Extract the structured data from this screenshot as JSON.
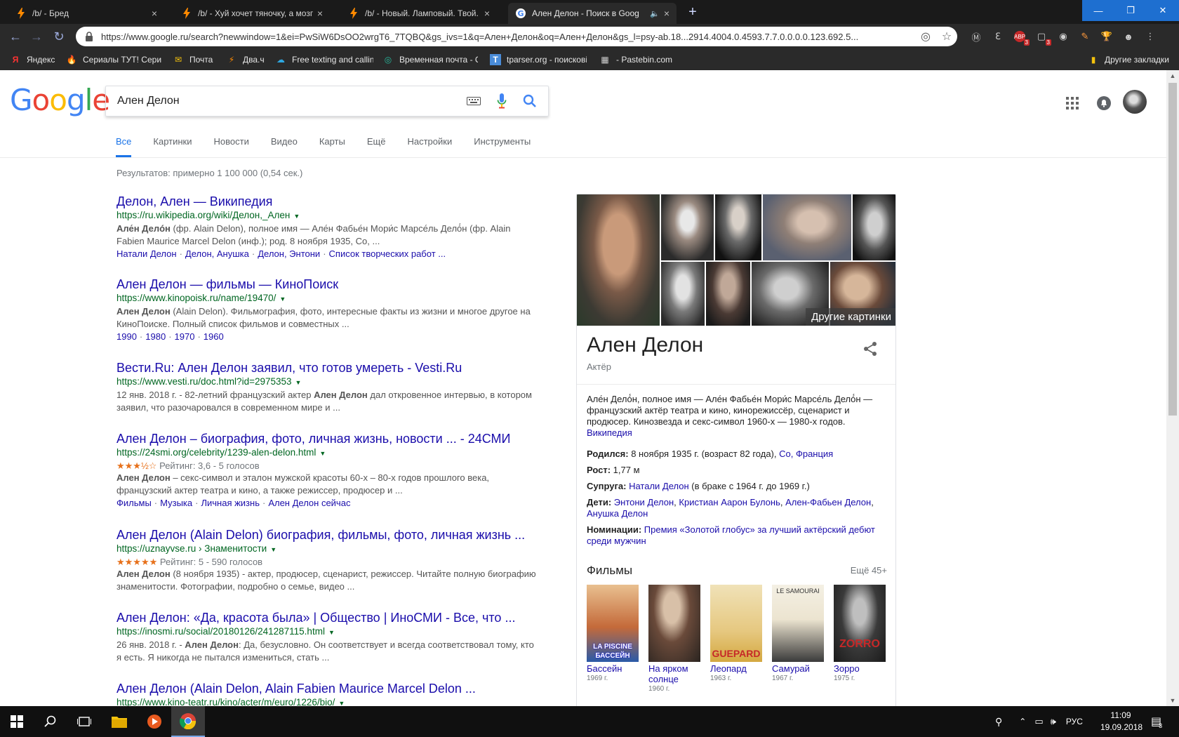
{
  "browser": {
    "tabs": [
      {
        "title": "/b/ - Бред",
        "close": "×",
        "active": false
      },
      {
        "title": "/b/ - Хуй хочет тяночку, а мозг ",
        "close": "×",
        "active": false
      },
      {
        "title": "/b/ - Новый. Ламповый. Твой. Б",
        "close": "×",
        "active": false
      },
      {
        "title": "Ален Делон - Поиск в Goog",
        "close": "×",
        "active": true
      }
    ],
    "new_tab": "+",
    "window_controls": {
      "minimize": "—",
      "maximize": "❐",
      "close": "✕"
    },
    "url": "https://www.google.ru/search?newwindow=1&ei=PwSiW6DsOO2wrgT6_7TQBQ&gs_ivs=1&q=Ален+Делон&oq=Ален+Делон&gs_l=psy-ab.18...2914.4004.0.4593.7.7.0.0.0.0.123.692.5...",
    "extension_badges": [
      "3",
      "3"
    ],
    "bookmarks": [
      {
        "label": "Яндекс",
        "icon": "Я",
        "color": "#ff3333"
      },
      {
        "label": "Сериалы ТУТ! Сериа",
        "icon": "🔥",
        "color": "#ff8a00"
      },
      {
        "label": "Почта",
        "icon": "✉",
        "color": "#f4c20d"
      },
      {
        "label": "Два.ч",
        "icon": "⚡",
        "color": "#ff8a00"
      },
      {
        "label": "Free texting and callin",
        "icon": "☁",
        "color": "#2ea7e0"
      },
      {
        "label": "Временная почта - С",
        "icon": "◎",
        "color": "#27b89b"
      },
      {
        "label": "tparser.org - поискові",
        "icon": "T",
        "color": "#4a8cd8"
      },
      {
        "label": "- Pastebin.com",
        "icon": "▦",
        "color": "#cccccc"
      }
    ],
    "other_bookmarks": "Другие закладки"
  },
  "google": {
    "logo": [
      "G",
      "o",
      "o",
      "g",
      "l",
      "e"
    ],
    "logo_colors": [
      "#4285F4",
      "#EA4335",
      "#FBBC05",
      "#4285F4",
      "#34A853",
      "#EA4335"
    ],
    "query": "Ален Делон",
    "tabs": [
      "Все",
      "Картинки",
      "Новости",
      "Видео",
      "Карты",
      "Ещё",
      "Настройки",
      "Инструменты"
    ],
    "stats": "Результатов: примерно 1 100 000 (0,54 сек.)"
  },
  "results": [
    {
      "title": "Делон, Ален — Википедия",
      "url": "https://ru.wikipedia.org/wiki/Делон,_Ален",
      "snippet_html": "<b>Але́н Делó́н</b> (фр. Alain Delon), полное имя — Але́н Фабье́н Мори́с Марсе́ль Делó́н (фр. Alain Fabien Maurice Marcel Delon (инф.); род. 8 ноября 1935, Со, ...",
      "links": [
        "Натали Делон",
        "Делон, Анушка",
        "Делон, Энтони",
        "Список творческих работ ..."
      ]
    },
    {
      "title": "Ален Делон — фильмы — КиноПоиск",
      "url": "https://www.kinopoisk.ru/name/19470/",
      "snippet_html": "<b>Ален Делон</b> (Alain Delon). Фильмография, фото, интересные факты из жизни и многое другое на КиноПоиске. Полный список фильмов и совместных ...",
      "links": [
        "1990",
        "1980",
        "1970",
        "1960"
      ]
    },
    {
      "title": "Вести.Ru: Ален Делон заявил, что готов умереть - Vesti.Ru",
      "url": "https://www.vesti.ru/doc.html?id=2975353",
      "snippet_html": "12 янв. 2018 г. - 82-летний французский актер <b>Ален Делон</b> дал откровенное интервью, в котором заявил, что разочаровался в современном мире и ..."
    },
    {
      "title": "Ален Делон – биография, фото, личная жизнь, новости ... - 24СМИ",
      "url": "https://24smi.org/celebrity/1239-alen-delon.html",
      "stars": "★★★½☆",
      "rating": "Рейтинг: 3,6 - 5 голосов",
      "snippet_html": "<b>Ален Делон</b> – секс-символ и эталон мужской красоты 60-х – 80-х годов прошлого века, французский актер театра и кино, а также режиссер, продюсер и ...",
      "links": [
        "Фильмы",
        "Музыка",
        "Личная жизнь",
        "Ален Делон сейчас"
      ]
    },
    {
      "title": "Ален Делон (Alain Delon) биография, фильмы, фото, личная жизнь ...",
      "url": "https://uznayvse.ru › Знаменитости",
      "stars": "★★★★★",
      "rating": "Рейтинг: 5 - 590 голосов",
      "snippet_html": "<b>Ален Делон</b> (8 ноября 1935) - актер, продюсер, сценарист, режиссер. Читайте полную биографию знаменитости. Фотографии, подробно о семье, видео ..."
    },
    {
      "title": "Ален Делон: «Да, красота была» | Общество | ИноСМИ - Все, что ...",
      "url": "https://inosmi.ru/social/20180126/241287115.html",
      "snippet_html": "26 янв. 2018 г. - <b>Ален Делон</b>: Да, безусловно. Он соответствует и всегда соответствовал тому, кто я есть. Я никогда не пытался измениться, стать ..."
    },
    {
      "title": "Ален Делон (Alain Delon, Alain Fabien Maurice Marcel Delon ...",
      "url": "https://www.kino-teatr.ru/kino/acter/m/euro/1226/bio/"
    }
  ],
  "knowledge_panel": {
    "more_images": "Другие картинки",
    "name": "Ален Делон",
    "type": "Актёр",
    "description": "Але́н Делó́н, полное имя — Але́н Фабье́н Мори́с Марсе́ль Делó́н — французский актёр театра и кино, кинорежиссёр, сценарист и продюсер. Кинозвезда и секс-символ 1960-х — 1980-х годов.",
    "source": "Википедия",
    "facts": [
      {
        "label": "Родился:",
        "text": "8 ноября 1935 г. (возраст 82 года), ",
        "links": [
          "Со, Франция"
        ]
      },
      {
        "label": "Рост:",
        "text": "1,77 м"
      },
      {
        "label": "Супруга:",
        "links": [
          "Натали Делон"
        ],
        "after": " (в браке с 1964 г. до 1969 г.)"
      },
      {
        "label": "Дети:",
        "links": [
          "Энтони Делон",
          "Кристиан Аарон Булонь",
          "Ален-Фабьен Делон",
          "Анушка Делон"
        ]
      },
      {
        "label": "Номинации:",
        "links": [
          "Премия «Золотой глобус» за лучший актёрский дебют среди мужчин"
        ]
      }
    ],
    "films_title": "Фильмы",
    "films_more": "Ещё 45+",
    "films": [
      {
        "name": "Бассейн",
        "year": "1969 г.",
        "poster_text": "LA PISCINE БАССЕЙН"
      },
      {
        "name": "На ярком солнце",
        "year": "1960 г.",
        "poster_text": ""
      },
      {
        "name": "Леопард",
        "year": "1963 г.",
        "poster_text": "GUEPARD"
      },
      {
        "name": "Самурай",
        "year": "1967 г.",
        "poster_text": "LE SAMOURAI"
      },
      {
        "name": "Зорро",
        "year": "1975 г.",
        "poster_text": "ZORRO"
      }
    ]
  },
  "taskbar": {
    "language": "РУС",
    "time": "11:09",
    "date": "19.09.2018",
    "notifications": "3"
  }
}
